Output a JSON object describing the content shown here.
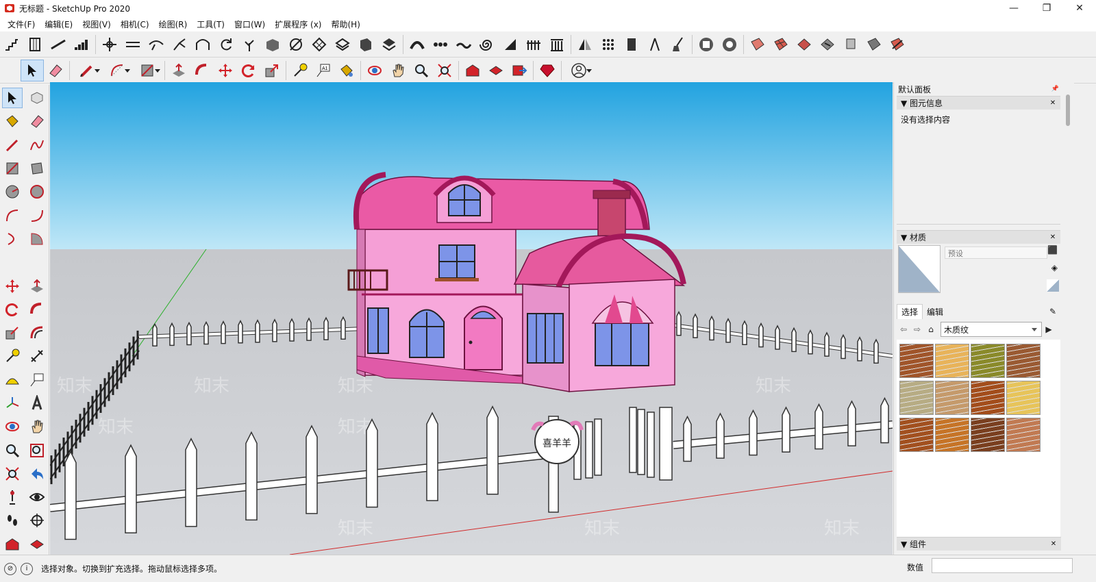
{
  "window": {
    "title": "无标题 - SketchUp Pro 2020",
    "min": "—",
    "max": "❐",
    "close": "✕"
  },
  "menu": [
    "文件(F)",
    "编辑(E)",
    "视图(V)",
    "相机(C)",
    "绘图(R)",
    "工具(T)",
    "窗口(W)",
    "扩展程序 (x)",
    "帮助(H)"
  ],
  "panel": {
    "title": "默认面板",
    "entity": {
      "header": "图元信息",
      "text": "没有选择内容"
    },
    "materials": {
      "header": "材质",
      "name_placeholder": "预设",
      "tabs": [
        "选择",
        "编辑"
      ],
      "collection": "木质纹"
    },
    "components": {
      "header": "组件"
    }
  },
  "status": {
    "hint": "选择对象。切换到扩充选择。拖动鼠标选择多项。",
    "vcb_label": "数值"
  },
  "viewport": {
    "sky_top": "#22a3e0",
    "sky_bottom": "#bfe7f7",
    "ground": "#c9cbd0",
    "house_color": "#f49fd8",
    "roof_color": "#e8529f",
    "trim_color": "#a3185a",
    "sign_text": "喜羊羊",
    "watermark": "知末"
  },
  "textures": [
    "#a0552a",
    "#e8b35a",
    "#8a8a2a",
    "#9a5a32",
    "#b7ac84",
    "#c59a6b",
    "#a34d1b",
    "#e7c45a",
    "#a2501f",
    "#c67427",
    "#7a3f1f",
    "#c17a52"
  ]
}
